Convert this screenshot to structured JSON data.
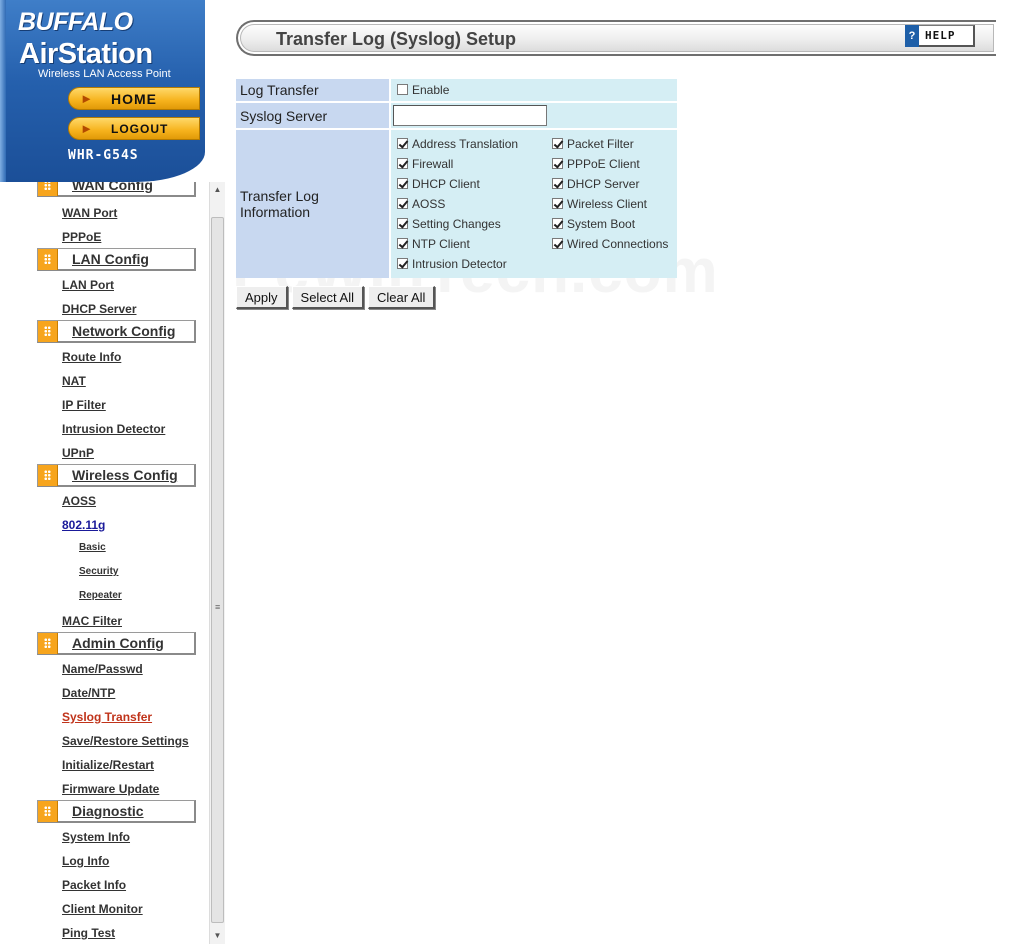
{
  "brand": {
    "company": "BUFFALO",
    "product": "AirStation",
    "tagline": "Wireless LAN Access Point",
    "model": "WHR-G54S",
    "home_label": "HOME",
    "logout_label": "LOGOUT"
  },
  "sidebar": {
    "sections": [
      {
        "label": "WAN Config",
        "items": [
          "WAN Port",
          "PPPoE"
        ]
      },
      {
        "label": "LAN Config",
        "items": [
          "LAN Port",
          "DHCP Server"
        ]
      },
      {
        "label": "Network Config",
        "items": [
          "Route Info",
          "NAT",
          "IP Filter",
          "Intrusion Detector",
          "UPnP"
        ]
      },
      {
        "label": "Wireless Config",
        "items": [
          "AOSS",
          "802.11g",
          "Basic",
          "Security",
          "Repeater",
          "MAC Filter"
        ]
      },
      {
        "label": "Admin Config",
        "items": [
          "Name/Passwd",
          "Date/NTP",
          "Syslog Transfer",
          "Save/Restore Settings",
          "Initialize/Restart",
          "Firmware Update"
        ]
      },
      {
        "label": "Diagnostic",
        "items": [
          "System Info",
          "Log Info",
          "Packet Info",
          "Client Monitor",
          "Ping Test"
        ]
      }
    ]
  },
  "page": {
    "title": "Transfer Log (Syslog) Setup",
    "help_label": "HELP",
    "help_icon": "?"
  },
  "form": {
    "log_transfer_label": "Log Transfer",
    "enable_label": "Enable",
    "enable_checked": false,
    "syslog_server_label": "Syslog Server",
    "syslog_server_value": "",
    "transfer_info_label": "Transfer Log Information",
    "options_left": [
      {
        "label": "Address Translation",
        "checked": true
      },
      {
        "label": "Firewall",
        "checked": true
      },
      {
        "label": "DHCP Client",
        "checked": true
      },
      {
        "label": "AOSS",
        "checked": true
      },
      {
        "label": "Setting Changes",
        "checked": true
      },
      {
        "label": "NTP Client",
        "checked": true
      },
      {
        "label": "Intrusion Detector",
        "checked": true
      }
    ],
    "options_right": [
      {
        "label": "Packet Filter",
        "checked": true
      },
      {
        "label": "PPPoE Client",
        "checked": true
      },
      {
        "label": "DHCP Server",
        "checked": true
      },
      {
        "label": "Wireless Client",
        "checked": true
      },
      {
        "label": "System Boot",
        "checked": true
      },
      {
        "label": "Wired Connections",
        "checked": true
      }
    ]
  },
  "buttons": {
    "apply": "Apply",
    "select_all": "Select All",
    "clear_all": "Clear All"
  },
  "watermark": "PcWinTech.com",
  "colors": {
    "label_cell": "#c8d8f0",
    "value_cell": "#d5eef4",
    "accent_orange": "#f7a51d",
    "brand_blue": "#2560ad",
    "active_link": "#c0331a"
  }
}
